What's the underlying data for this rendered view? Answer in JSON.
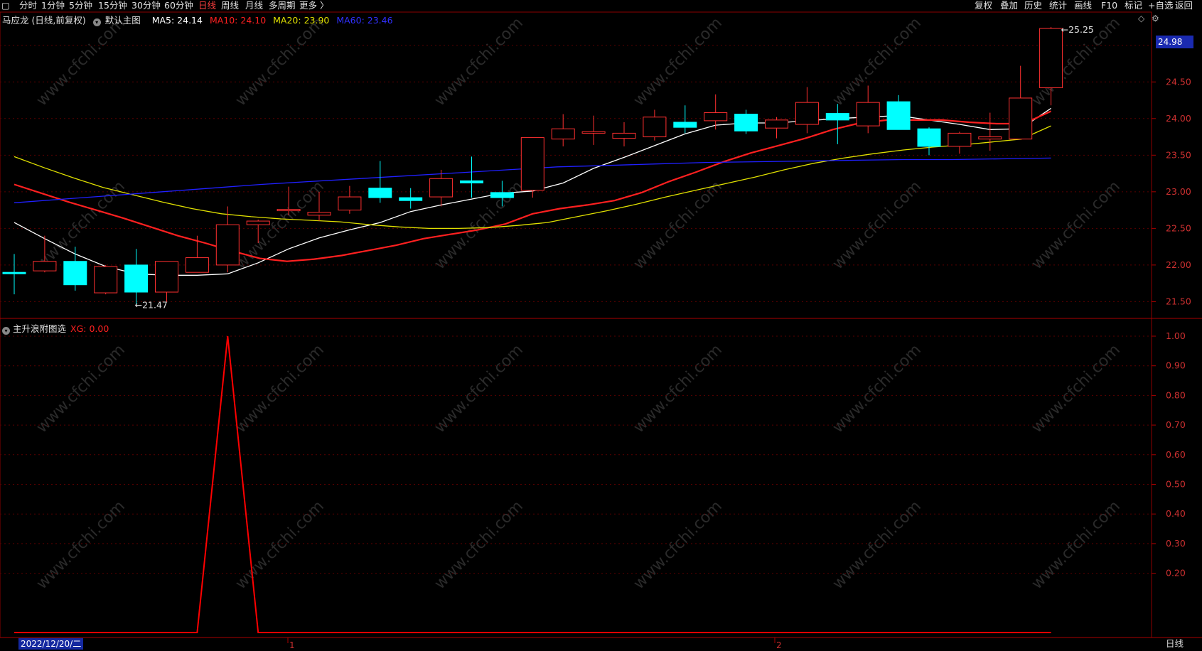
{
  "toolbar": {
    "left_items": [
      "分时",
      "1分钟",
      "5分钟",
      "15分钟",
      "30分钟",
      "60分钟",
      "日线",
      "周线",
      "月线",
      "多周期",
      "更多 〉"
    ],
    "active": "日线",
    "right_items": [
      "复权",
      "叠加",
      "历史",
      "统计",
      "画线",
      "F10",
      "标记",
      "+自选",
      "返回"
    ]
  },
  "main_panel": {
    "title": "马应龙 (日线,前复权)",
    "indicator": "默认主图",
    "ma5": "MA5: 24.14",
    "ma10": "MA10: 24.10",
    "ma20": "MA20: 23.90",
    "ma60": "MA60: 23.46",
    "high_label": "25.25",
    "low_label": "21.47",
    "current_price": "24.98",
    "y_ticks": [
      "24.50",
      "24.00",
      "23.50",
      "23.00",
      "22.50",
      "22.00",
      "21.50"
    ]
  },
  "sub_panel": {
    "title": "主升浪附图选",
    "xg": "XG: 0.00",
    "y_ticks": [
      "1.00",
      "0.90",
      "0.80",
      "0.70",
      "0.60",
      "0.50",
      "0.40",
      "0.30",
      "0.20"
    ]
  },
  "bottom": {
    "date": "2022/12/20/二",
    "period": "日线",
    "month_marks": [
      "1",
      "2"
    ]
  },
  "watermark": "www.cfchi.com",
  "colors": {
    "up": "#ff3030",
    "down": "#00ffff",
    "ma5": "#ffffff",
    "ma10": "#ff2020",
    "ma20": "#e0e000",
    "ma60": "#2020ff",
    "xg_line": "#ff0000",
    "background": "#000000"
  },
  "chart_data": [
    {
      "type": "candlestick",
      "title": "马应龙 (日线,前复权)",
      "ylim": [
        21.3,
        25.3
      ],
      "candles": [
        {
          "o": 21.9,
          "h": 22.15,
          "l": 21.6,
          "c": 21.88
        },
        {
          "o": 21.92,
          "h": 22.4,
          "l": 21.9,
          "c": 22.05
        },
        {
          "o": 22.05,
          "h": 22.25,
          "l": 21.65,
          "c": 21.73
        },
        {
          "o": 21.62,
          "h": 22.0,
          "l": 21.6,
          "c": 21.98
        },
        {
          "o": 22.0,
          "h": 22.22,
          "l": 21.47,
          "c": 21.63
        },
        {
          "o": 21.63,
          "h": 22.05,
          "l": 21.5,
          "c": 22.05
        },
        {
          "o": 21.9,
          "h": 22.4,
          "l": 21.9,
          "c": 22.1
        },
        {
          "o": 22.0,
          "h": 22.8,
          "l": 21.9,
          "c": 22.55
        },
        {
          "o": 22.55,
          "h": 22.62,
          "l": 22.3,
          "c": 22.6
        },
        {
          "o": 22.75,
          "h": 23.07,
          "l": 22.68,
          "c": 22.76
        },
        {
          "o": 22.68,
          "h": 23.0,
          "l": 22.6,
          "c": 22.72
        },
        {
          "o": 22.75,
          "h": 23.08,
          "l": 22.7,
          "c": 22.93
        },
        {
          "o": 23.05,
          "h": 23.42,
          "l": 22.85,
          "c": 22.92
        },
        {
          "o": 22.92,
          "h": 23.05,
          "l": 22.77,
          "c": 22.88
        },
        {
          "o": 22.93,
          "h": 23.3,
          "l": 22.8,
          "c": 23.18
        },
        {
          "o": 23.15,
          "h": 23.48,
          "l": 22.92,
          "c": 23.12
        },
        {
          "o": 22.99,
          "h": 23.15,
          "l": 22.8,
          "c": 22.92
        },
        {
          "o": 23.02,
          "h": 23.74,
          "l": 22.92,
          "c": 23.74
        },
        {
          "o": 23.72,
          "h": 24.06,
          "l": 23.62,
          "c": 23.86
        },
        {
          "o": 23.8,
          "h": 24.04,
          "l": 23.64,
          "c": 23.82
        },
        {
          "o": 23.73,
          "h": 23.95,
          "l": 23.62,
          "c": 23.8
        },
        {
          "o": 23.75,
          "h": 24.12,
          "l": 23.7,
          "c": 24.02
        },
        {
          "o": 23.95,
          "h": 24.18,
          "l": 23.8,
          "c": 23.88
        },
        {
          "o": 23.97,
          "h": 24.33,
          "l": 23.85,
          "c": 24.08
        },
        {
          "o": 24.06,
          "h": 24.12,
          "l": 23.79,
          "c": 23.83
        },
        {
          "o": 23.87,
          "h": 24.02,
          "l": 23.73,
          "c": 23.98
        },
        {
          "o": 23.92,
          "h": 24.43,
          "l": 23.8,
          "c": 24.22
        },
        {
          "o": 24.07,
          "h": 24.2,
          "l": 23.65,
          "c": 23.98
        },
        {
          "o": 23.9,
          "h": 24.45,
          "l": 23.8,
          "c": 24.22
        },
        {
          "o": 24.23,
          "h": 24.32,
          "l": 23.85,
          "c": 23.85
        },
        {
          "o": 23.86,
          "h": 23.88,
          "l": 23.5,
          "c": 23.62
        },
        {
          "o": 23.62,
          "h": 23.82,
          "l": 23.52,
          "c": 23.8
        },
        {
          "o": 23.72,
          "h": 24.08,
          "l": 23.56,
          "c": 23.75
        },
        {
          "o": 23.72,
          "h": 24.72,
          "l": 23.72,
          "c": 24.28
        },
        {
          "o": 24.42,
          "h": 25.25,
          "l": 24.18,
          "c": 25.23
        }
      ],
      "series": [
        {
          "name": "MA5",
          "values": [
            22.58,
            22.36,
            22.15,
            21.98,
            21.88,
            21.86,
            21.86,
            21.88,
            22.03,
            22.22,
            22.37,
            22.48,
            22.58,
            22.73,
            22.82,
            22.9,
            22.98,
            23.01,
            23.12,
            23.32,
            23.47,
            23.63,
            23.79,
            23.91,
            23.94,
            23.94,
            23.97,
            24.0,
            24.02,
            24.04,
            23.98,
            23.92,
            23.85,
            23.86,
            24.14
          ]
        },
        {
          "name": "MA10",
          "values": [
            23.1,
            22.98,
            22.86,
            22.75,
            22.64,
            22.52,
            22.4,
            22.3,
            22.19,
            22.09,
            22.05,
            22.08,
            22.13,
            22.2,
            22.27,
            22.36,
            22.42,
            22.48,
            22.56,
            22.7,
            22.77,
            22.82,
            22.88,
            22.99,
            23.14,
            23.27,
            23.41,
            23.53,
            23.63,
            23.73,
            23.85,
            23.94,
            23.98,
            23.98,
            23.98,
            23.95,
            23.93,
            23.93,
            24.1
          ]
        },
        {
          "name": "MA20",
          "values": [
            23.48,
            23.33,
            23.19,
            23.06,
            22.96,
            22.86,
            22.77,
            22.7,
            22.66,
            22.63,
            22.61,
            22.59,
            22.55,
            22.52,
            22.5,
            22.5,
            22.51,
            22.54,
            22.58,
            22.66,
            22.74,
            22.83,
            22.93,
            23.02,
            23.11,
            23.2,
            23.3,
            23.39,
            23.46,
            23.52,
            23.57,
            23.61,
            23.64,
            23.68,
            23.72,
            23.9
          ]
        },
        {
          "name": "MA60",
          "values": [
            22.85,
            22.9,
            22.95,
            23.0,
            23.05,
            23.1,
            23.14,
            23.18,
            23.22,
            23.26,
            23.3,
            23.34,
            23.36,
            23.38,
            23.4,
            23.41,
            23.42,
            23.43,
            23.44,
            23.44,
            23.45,
            23.46
          ]
        }
      ]
    },
    {
      "type": "line",
      "title": "主升浪附图选",
      "ylim": [
        0,
        1.0
      ],
      "series": [
        {
          "name": "XG",
          "values": [
            0,
            0,
            0,
            0,
            0,
            0,
            0,
            1,
            0,
            0,
            0,
            0,
            0,
            0,
            0,
            0,
            0,
            0,
            0,
            0,
            0,
            0,
            0,
            0,
            0,
            0,
            0,
            0,
            0,
            0,
            0,
            0,
            0,
            0,
            0
          ]
        }
      ]
    }
  ]
}
